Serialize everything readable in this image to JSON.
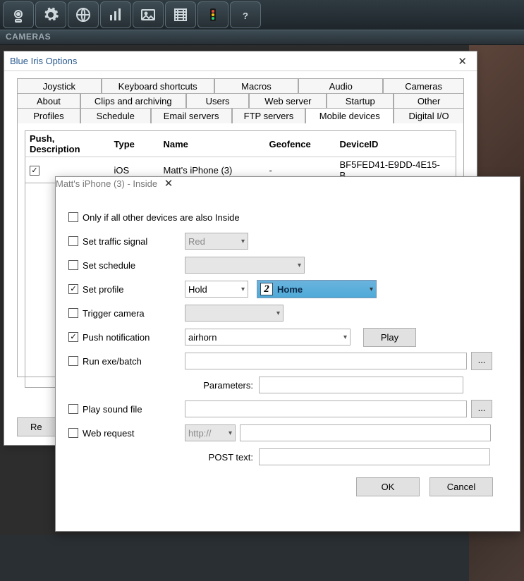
{
  "toolbar": {
    "icons": [
      "camera",
      "gear",
      "globe",
      "chart",
      "image",
      "film",
      "traffic",
      "help"
    ]
  },
  "section_header": "CAMERAS",
  "options_dialog": {
    "title": "Blue Iris Options",
    "tabs_row1": [
      "Joystick",
      "Keyboard shortcuts",
      "Macros",
      "Audio",
      "Cameras"
    ],
    "tabs_row2": [
      "About",
      "Clips and archiving",
      "Users",
      "Web server",
      "Startup",
      "Other"
    ],
    "tabs_row3": [
      "Profiles",
      "Schedule",
      "Email servers",
      "FTP servers",
      "Mobile devices",
      "Digital I/O"
    ],
    "active_tab": "Mobile devices",
    "table": {
      "headers": [
        "Push, Description",
        "Type",
        "Name",
        "Geofence",
        "DeviceID"
      ],
      "rows": [
        {
          "push": true,
          "description": "",
          "type": "iOS",
          "name": "Matt's iPhone (3)",
          "geofence": "-",
          "deviceid": "BF5FED41-E9DD-4E15-B..."
        }
      ]
    },
    "button_partial": "Re"
  },
  "sub_dialog": {
    "title": "Matt's iPhone (3) - Inside",
    "rows": {
      "only_inside": {
        "checked": false,
        "label": "Only if all other devices are also Inside"
      },
      "set_traffic": {
        "checked": false,
        "label": "Set traffic signal",
        "value": "Red"
      },
      "set_schedule": {
        "checked": false,
        "label": "Set schedule",
        "value": ""
      },
      "set_profile": {
        "checked": true,
        "label": "Set profile",
        "mode": "Hold",
        "profile_num": "2",
        "profile_name": "Home"
      },
      "trigger_cam": {
        "checked": false,
        "label": "Trigger camera",
        "value": ""
      },
      "push_notif": {
        "checked": true,
        "label": "Push notification",
        "sound": "airhorn",
        "play_btn": "Play"
      },
      "run_exe": {
        "checked": false,
        "label": "Run exe/batch",
        "params_label": "Parameters:",
        "path": "",
        "params": ""
      },
      "play_sound": {
        "checked": false,
        "label": "Play sound file",
        "path": ""
      },
      "web_request": {
        "checked": false,
        "label": "Web request",
        "scheme": "http://",
        "url": "",
        "post_label": "POST text:",
        "post": ""
      }
    },
    "ok": "OK",
    "cancel": "Cancel",
    "browse": "..."
  }
}
